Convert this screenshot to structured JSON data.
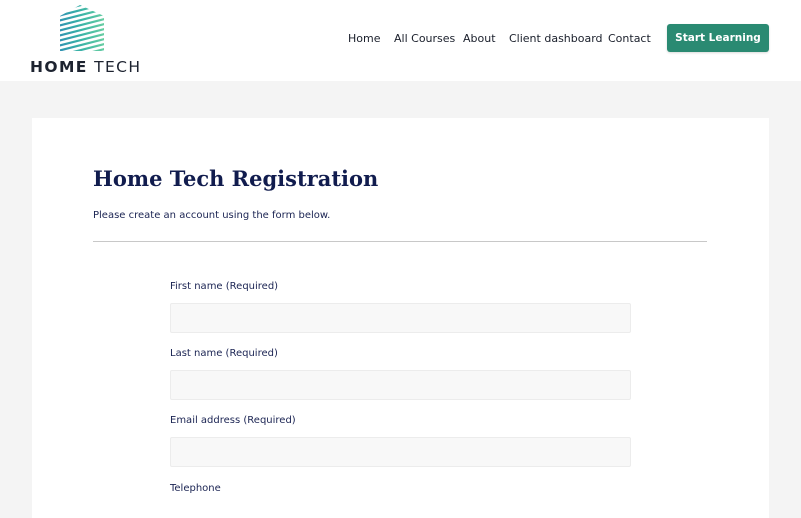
{
  "brand": {
    "name_bold": "HOME",
    "name_light": " TECH",
    "colors": {
      "logo_top": "#7fdba0",
      "logo_bottom": "#2a7fb8",
      "accent": "#2a8a72",
      "heading": "#111c4e"
    }
  },
  "nav": {
    "items": [
      {
        "label": "Home"
      },
      {
        "label": "All Courses"
      },
      {
        "label": "About"
      },
      {
        "label": "Client dashboard"
      },
      {
        "label": "Contact"
      }
    ],
    "cta_label": "Start Learning"
  },
  "form": {
    "title": "Home Tech Registration",
    "subtitle": "Please create an account using the form below.",
    "fields": [
      {
        "label": "First name (Required)",
        "value": ""
      },
      {
        "label": "Last name (Required)",
        "value": ""
      },
      {
        "label": "Email address (Required)",
        "value": ""
      },
      {
        "label": "Telephone",
        "value": ""
      }
    ]
  }
}
